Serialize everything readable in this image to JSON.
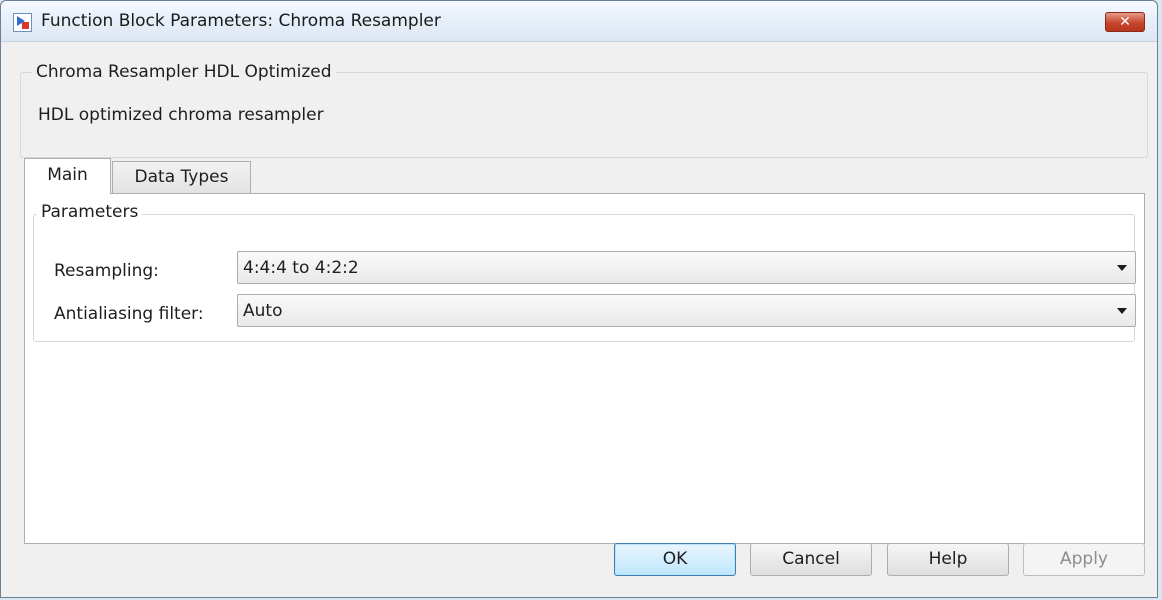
{
  "window": {
    "title": "Function Block Parameters: Chroma Resampler",
    "close_label": "✕"
  },
  "description": {
    "group_title": "Chroma Resampler HDL Optimized",
    "text": "HDL optimized chroma resampler"
  },
  "tabs": [
    {
      "label": "Main",
      "selected": true
    },
    {
      "label": "Data Types",
      "selected": false
    }
  ],
  "parameters": {
    "group_title": "Parameters",
    "resampling": {
      "label": "Resampling:",
      "value": "4:4:4 to 4:2:2"
    },
    "antialiasing_filter": {
      "label": "Antialiasing filter:",
      "value": "Auto"
    }
  },
  "buttons": {
    "ok": "OK",
    "cancel": "Cancel",
    "help": "Help",
    "apply": "Apply"
  },
  "icons": {
    "app": "simulink-block-icon",
    "close": "close-icon",
    "dropdown": "chevron-down-icon"
  },
  "colors": {
    "close_button": "#c7452c",
    "ok_button_border": "#3c7fb1",
    "panel_background": "#ffffff",
    "dialog_background": "#f0f0f0"
  }
}
